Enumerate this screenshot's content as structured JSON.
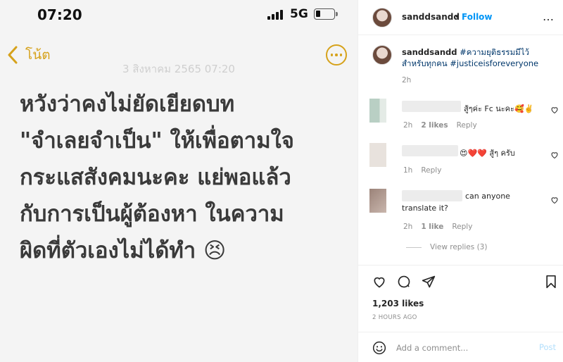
{
  "note_screen": {
    "status_time": "07:20",
    "network": "5G",
    "back_label": "โน้ต",
    "date": "3 สิงหาคม 2565 07:20",
    "body_lines": [
      "หวังว่าคงไม่ยัดเยียดบท",
      "\"จำเลยจำเป็น\" ให้เพื่อตามใจ",
      "กระแสสังคมนะคะ แย่พอแล้ว",
      "กับการเป็นผู้ต้องหา ในความ",
      "ผิดที่ตัวเองไม่ได้ทำ 😣"
    ],
    "accent_color": "#d6a21b",
    "battery_level": 0.25
  },
  "instagram": {
    "username": "sanddsandd",
    "dot": "•",
    "follow_label": "Follow",
    "more_icon": "…",
    "caption": {
      "username": "sanddsandd",
      "hashtags": "#ความยุติธรรมมีไว้สำหรับทุกคน #justiceisforeveryone",
      "time": "2h"
    },
    "comments": [
      {
        "text": "สู้ๆค่ะ Fc นะคะ🥰✌️",
        "time": "2h",
        "likes": "2 likes",
        "reply": "Reply"
      },
      {
        "text": "😍❤️❤️ สู้ๆ ครับ",
        "time": "1h",
        "reply": "Reply"
      },
      {
        "text_line1": "can anyone",
        "text_line2": "translate it?",
        "time": "2h",
        "likes": "1 like",
        "reply": "Reply"
      }
    ],
    "view_replies": "View replies (3)",
    "likes_count": "1,203 likes",
    "posted_ago": "2 HOURS AGO",
    "comment_placeholder": "Add a comment...",
    "post_label": "Post",
    "colors": {
      "link": "#0095f6",
      "hashtag": "#00376b",
      "muted": "#8e8e8e",
      "post_disabled": "#b2dffc"
    }
  }
}
